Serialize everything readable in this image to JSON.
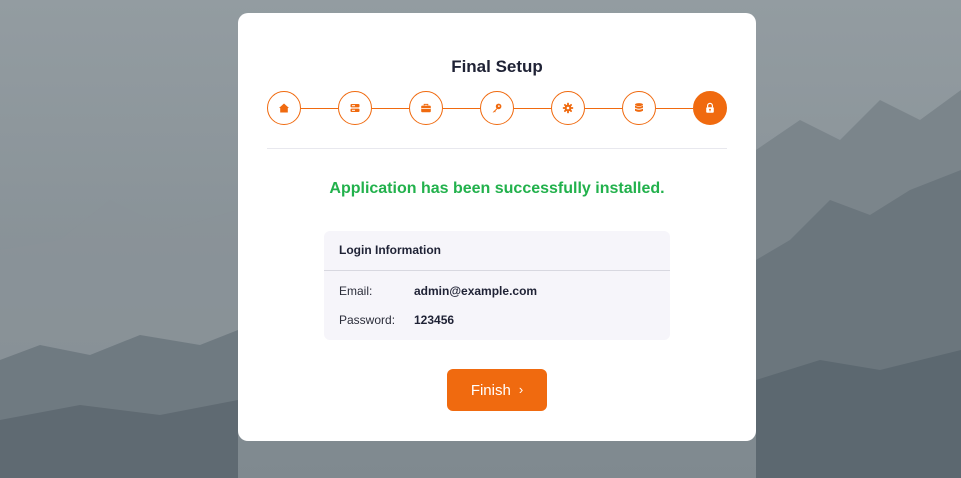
{
  "page": {
    "title": "Final Setup",
    "accent_color": "#f06a0f",
    "success_color": "#22b14c"
  },
  "steps": [
    {
      "icon": "home-icon",
      "state": "done"
    },
    {
      "icon": "server-icon",
      "state": "done"
    },
    {
      "icon": "briefcase-icon",
      "state": "done"
    },
    {
      "icon": "key-icon",
      "state": "done"
    },
    {
      "icon": "gear-icon",
      "state": "done"
    },
    {
      "icon": "database-icon",
      "state": "done"
    },
    {
      "icon": "lock-icon",
      "state": "active"
    }
  ],
  "message": "Application has been successfully installed.",
  "login": {
    "heading": "Login Information",
    "email_label": "Email:",
    "email_value": "admin@example.com",
    "password_label": "Password:",
    "password_value": "123456"
  },
  "finish_button": {
    "label": "Finish",
    "icon": "chevron-right-icon"
  }
}
